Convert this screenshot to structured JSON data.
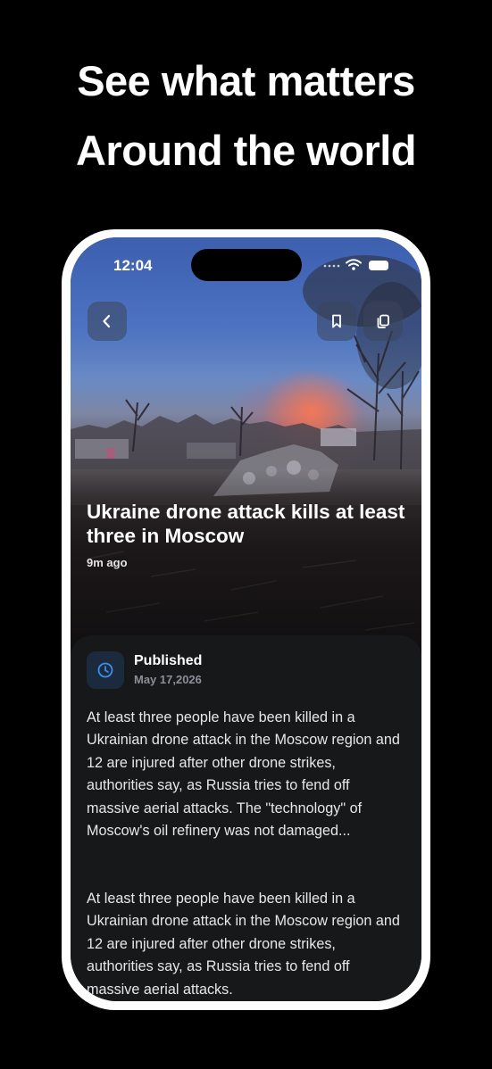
{
  "promo": {
    "line1": "See what matters",
    "line2": "Around the world"
  },
  "status_bar": {
    "time": "12:04"
  },
  "icons": {
    "back": "chevron-left-icon",
    "bookmark": "bookmark-icon",
    "copy": "copy-icon",
    "published": "clock-icon"
  },
  "article": {
    "title": "Ukraine drone attack kills at least three in Moscow",
    "age": "9m ago",
    "published_label": "Published",
    "published_date": "May 17,2026",
    "paragraphs": [
      "At least three people have been killed in a Ukrainian drone attack in the Moscow region and 12 are injured after other drone strikes, authorities say, as Russia tries to fend off massive aerial attacks. The \"technology\" of Moscow's oil refinery was not damaged...",
      "At least three people have been killed in a Ukrainian drone attack in the Moscow region and 12 are injured after other drone strikes, authorities say, as Russia tries to fend off massive aerial attacks."
    ]
  },
  "colors": {
    "background": "#000000",
    "sheet": "#16181a",
    "accent_blue": "#3b8df0"
  }
}
